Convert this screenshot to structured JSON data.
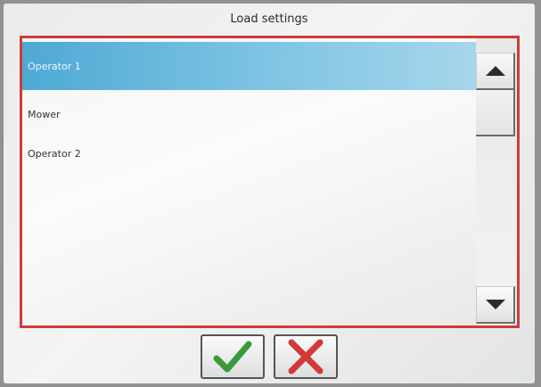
{
  "dialog": {
    "title": "Load settings"
  },
  "list": {
    "items": [
      {
        "label": "Operator 1",
        "selected": true
      },
      {
        "label": "Mower",
        "selected": false
      },
      {
        "label": "Operator 2",
        "selected": false
      }
    ]
  },
  "scrollbar": {
    "up_icon": "triangle-up-icon",
    "down_icon": "triangle-down-icon"
  },
  "buttons": {
    "confirm_icon": "checkmark-icon",
    "cancel_icon": "cross-icon"
  },
  "colors": {
    "frame": "#cf3b3b",
    "selection": "#4ea9d4",
    "confirm": "#3a9a3a",
    "cancel": "#d23a3a"
  }
}
